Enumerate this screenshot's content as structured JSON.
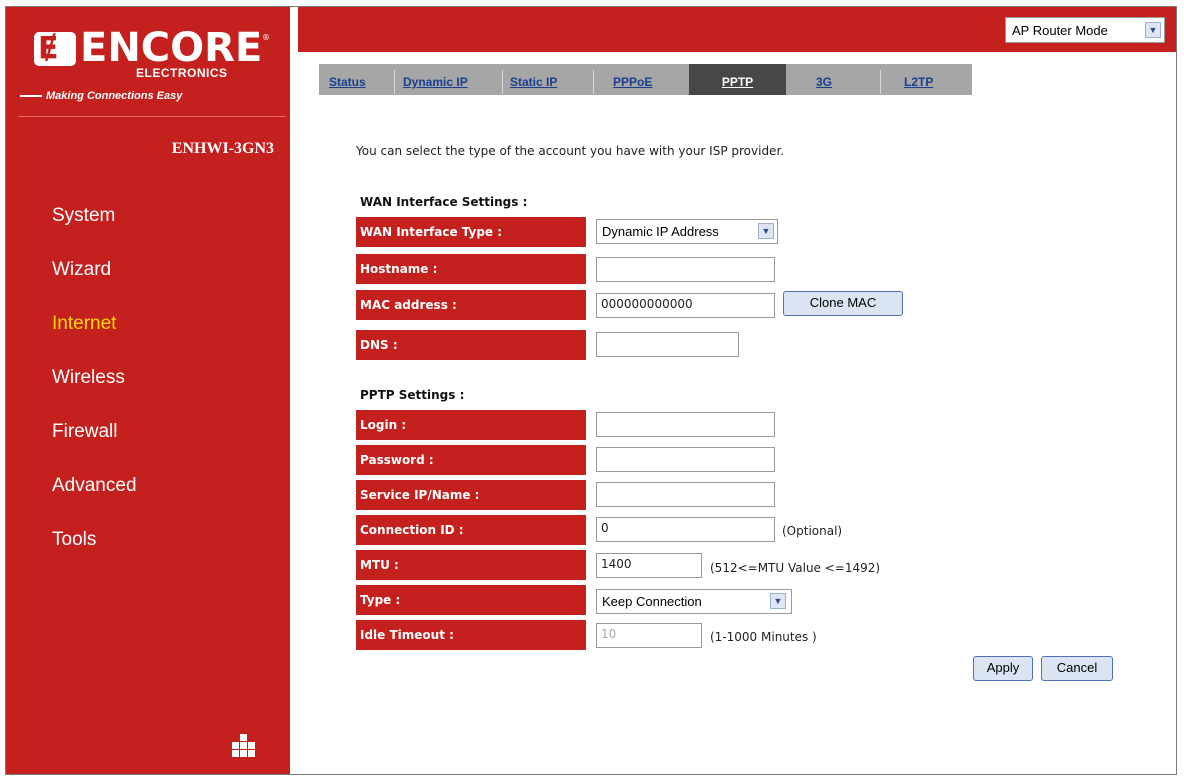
{
  "brand": {
    "logo_text": "ENCORE",
    "logo_sub": "ELECTRONICS",
    "tagline": "Making Connections Easy",
    "model": "ENHWI-3GN3"
  },
  "sidebar": {
    "items": [
      {
        "label": "System"
      },
      {
        "label": "Wizard"
      },
      {
        "label": "Internet"
      },
      {
        "label": "Wireless"
      },
      {
        "label": "Firewall"
      },
      {
        "label": "Advanced"
      },
      {
        "label": "Tools"
      }
    ],
    "active": "Internet"
  },
  "header": {
    "mode_select": "AP Router Mode"
  },
  "tabs": [
    {
      "label": "Status"
    },
    {
      "label": "Dynamic IP"
    },
    {
      "label": "Static IP"
    },
    {
      "label": "PPPoE"
    },
    {
      "label": "PPTP"
    },
    {
      "label": "3G"
    },
    {
      "label": "L2TP"
    }
  ],
  "active_tab": "PPTP",
  "main": {
    "intro": "You can select the type of the account you have with your ISP provider.",
    "wan_section": "WAN Interface Settings :",
    "wan_fields": {
      "type_label": "WAN Interface Type :",
      "type_value": "Dynamic IP Address",
      "hostname_label": "Hostname :",
      "hostname_value": "",
      "mac_label": "MAC address :",
      "mac_value": "000000000000",
      "clone_mac_button": "Clone MAC",
      "dns_label": "DNS :",
      "dns_value": ""
    },
    "pptp_section": "PPTP Settings :",
    "pptp_fields": {
      "login_label": "Login :",
      "login_value": "",
      "password_label": "Password :",
      "password_value": "",
      "service_label": "Service IP/Name :",
      "service_value": "",
      "connid_label": "Connection ID :",
      "connid_value": "0",
      "connid_note": "(Optional)",
      "mtu_label": "MTU :",
      "mtu_value": "1400",
      "mtu_note": "(512<=MTU Value <=1492)",
      "type_label": "Type :",
      "type_value": "Keep Connection",
      "idle_label": "Idle Timeout :",
      "idle_value": "10",
      "idle_note": "(1-1000 Minutes )"
    },
    "apply_button": "Apply",
    "cancel_button": "Cancel"
  },
  "colors": {
    "brand_red": "#c4201e",
    "active_nav": "#ffd800",
    "tab_bar": "#a6a6a6",
    "active_tab": "#474747"
  }
}
